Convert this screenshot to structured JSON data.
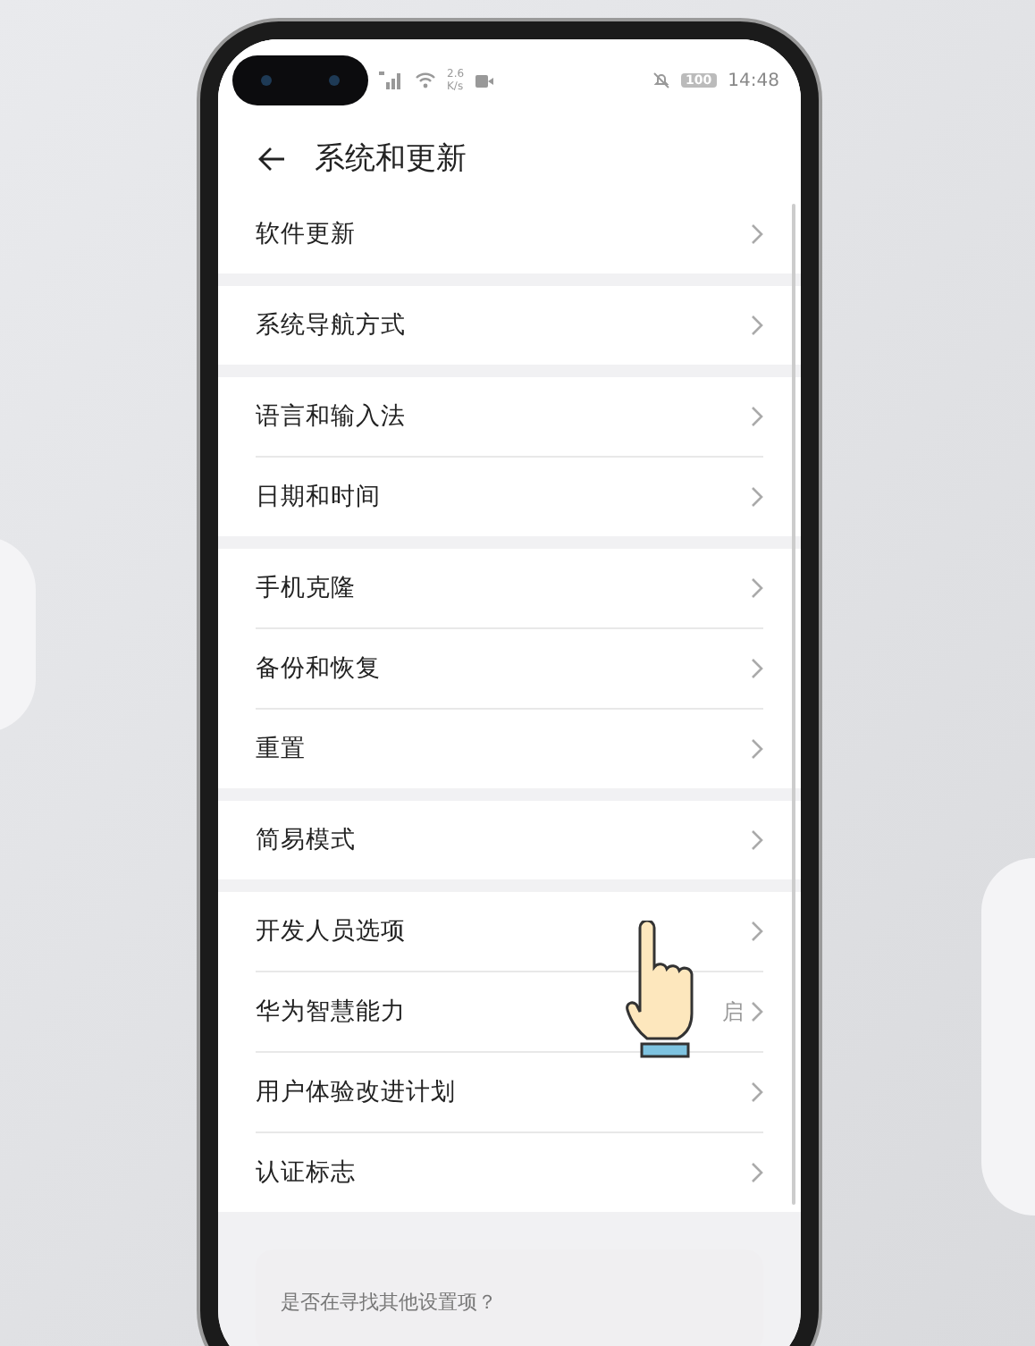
{
  "status_bar": {
    "network_speed": "2.6",
    "speed_unit": "K/s",
    "battery": "100",
    "time": "14:48"
  },
  "header": {
    "title": "系统和更新"
  },
  "groups": [
    {
      "items": [
        {
          "label": "软件更新"
        }
      ]
    },
    {
      "items": [
        {
          "label": "系统导航方式"
        }
      ]
    },
    {
      "items": [
        {
          "label": "语言和输入法"
        },
        {
          "label": "日期和时间"
        }
      ]
    },
    {
      "items": [
        {
          "label": "手机克隆"
        },
        {
          "label": "备份和恢复"
        },
        {
          "label": "重置"
        }
      ]
    },
    {
      "items": [
        {
          "label": "简易模式"
        }
      ]
    },
    {
      "items": [
        {
          "label": "开发人员选项"
        },
        {
          "label": "华为智慧能力",
          "value": "启"
        },
        {
          "label": "用户体验改进计划"
        },
        {
          "label": "认证标志"
        }
      ]
    }
  ],
  "search_card": {
    "text": "是否在寻找其他设置项？"
  }
}
